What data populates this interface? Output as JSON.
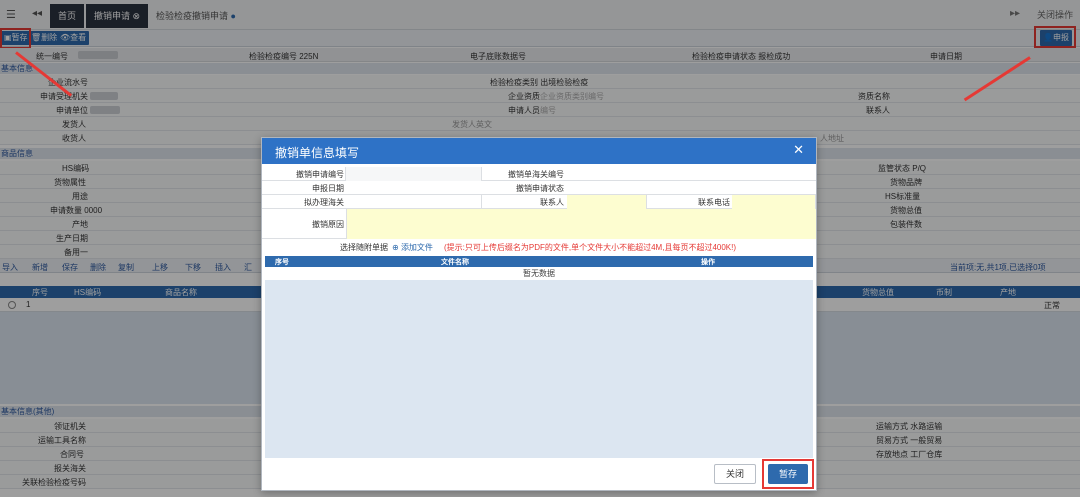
{
  "topbar": {
    "menu_icon": "hamburger-icon",
    "tabs": [
      "首页",
      "撤销申请",
      "检验检疫撤销申请"
    ],
    "close_ops": "关闭操作"
  },
  "toolbar": {
    "save": "暂存",
    "delete": "删除",
    "view": "查看",
    "declare": "申报"
  },
  "info": {
    "unified_no": "统一编号",
    "insp_no": "检验检疫编号",
    "insp_no_prefix": "225N",
    "e_bottom": "电子底账数据号",
    "status_label": "检验检疫申请状态",
    "status_value": "报检成功",
    "apply_date": "申请日期"
  },
  "sections": {
    "basic": "基本信息",
    "goods": "商品信息",
    "basic_other": "基本信息(其他)"
  },
  "basic_fields": {
    "flow_no": "企业流水号",
    "insp_type": "检验检疫类别",
    "insp_type_value": "出境检验检疫",
    "accept_org": "申请受理机关",
    "ent_qual": "企业资质",
    "ent_qual_ph": "企业资质类别编号",
    "qual_name": "资质名称",
    "apply_unit": "申请单位",
    "apply_person": "申请人员",
    "apply_person_ph": "编号",
    "contact": "联系人",
    "shipper": "发货人",
    "shipper_en": "发货人英文",
    "consignee": "收货人",
    "address": "人地址"
  },
  "goods_fields": {
    "hs": "HS编码",
    "goods_attr": "货物属性",
    "usage": "用途",
    "apply_qty": "申请数量",
    "apply_qty_prefix": "0000",
    "origin": "产地",
    "prod_date": "生产日期",
    "remark": "备用一",
    "supervision": "监管状态",
    "supervision_value": "P/Q",
    "brand": "货物品牌",
    "hs_std": "HS标准量",
    "total_value": "货物总值",
    "pack_count": "包装件数"
  },
  "grid": {
    "actions": [
      "导入",
      "新增",
      "保存",
      "删除",
      "复制",
      "上移",
      "下移",
      "插入",
      "汇"
    ],
    "summary": "当前项:无,共1项,已选择0项",
    "headers": [
      "序号",
      "HS编码",
      "商品名称",
      "货物总值",
      "币制",
      "产地"
    ],
    "row_no": "1",
    "row_state": "正常"
  },
  "other_fields": {
    "cert_org": "领证机关",
    "transport_name": "运输工具名称",
    "contract_no": "合同号",
    "customs": "报关海关",
    "related_no": "关联检验检疫号码",
    "transport_mode": "运输方式",
    "transport_mode_value": "水路运输",
    "trade_mode": "贸易方式",
    "trade_mode_value": "一般贸易",
    "storage": "存放地点",
    "storage_value": "工厂仓库"
  },
  "modal": {
    "title": "撤销单信息填写",
    "revoke_no": "撤销申请编号",
    "revoke_customs_no": "撤销单海关编号",
    "declare_date": "申报日期",
    "revoke_status": "撤销申请状态",
    "customs": "拟办理海关",
    "contact": "联系人",
    "phone": "联系电话",
    "reason": "撤销原因",
    "attach_label": "选择随附单据",
    "add_file": "添加文件",
    "hint": "(提示:只可上传后缀名为PDF的文件,单个文件大小不能超过4M,且每页不超过400K!)",
    "headers": [
      "序号",
      "文件名称",
      "操作"
    ],
    "no_data": "暂无数据",
    "close": "关闭",
    "save": "暂存"
  },
  "colors": {
    "accent": "#2e6aad",
    "highlight": "#e53935",
    "modal_header": "#2e72c6"
  }
}
